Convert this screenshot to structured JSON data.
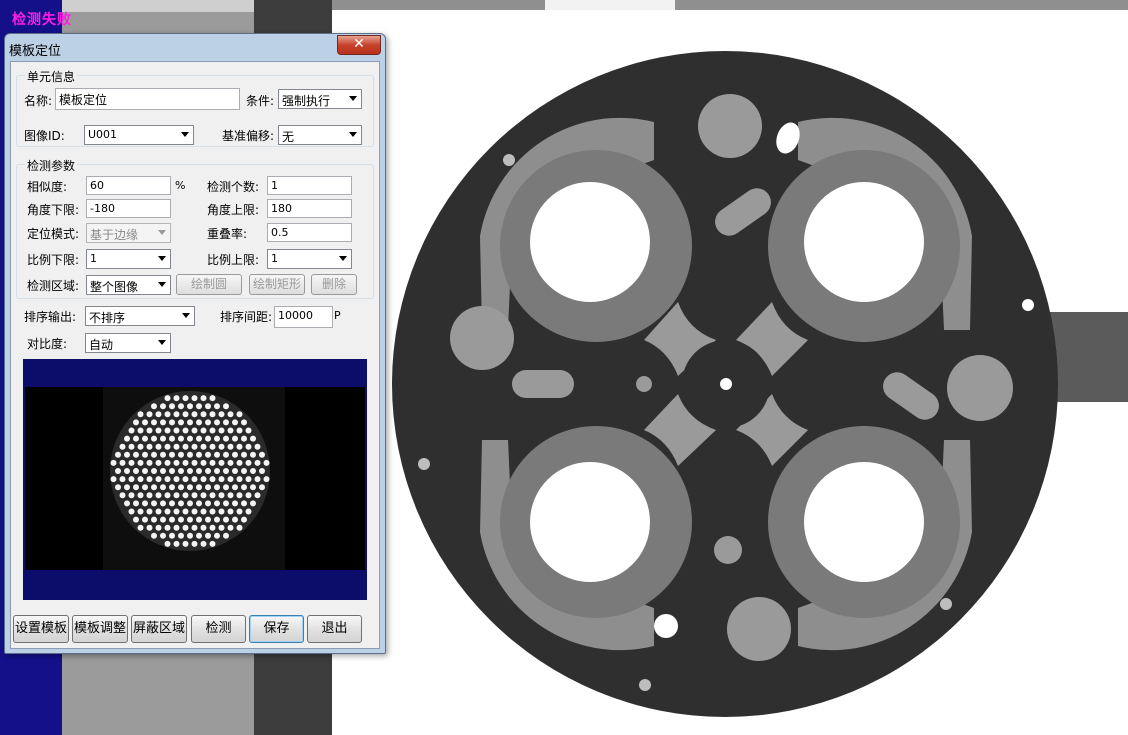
{
  "status": {
    "text": "检测失败",
    "color": "#ff1ce6"
  },
  "dialog": {
    "title": "模板定位",
    "close_icon": "✕",
    "unit_info": {
      "group_title": "单元信息",
      "name_label": "名称:",
      "name_value": "模板定位",
      "condition_label": "条件:",
      "condition_value": "强制执行",
      "image_id_label": "图像ID:",
      "image_id_value": "U001",
      "offset_label": "基准偏移:",
      "offset_value": "无"
    },
    "params": {
      "group_title": "检测参数",
      "similarity_label": "相似度:",
      "similarity_value": "60",
      "similarity_unit": "%",
      "count_label": "检测个数:",
      "count_value": "1",
      "angle_min_label": "角度下限:",
      "angle_min_value": "-180",
      "angle_max_label": "角度上限:",
      "angle_max_value": "180",
      "mode_label": "定位模式:",
      "mode_value": "基于边缘",
      "overlap_label": "重叠率:",
      "overlap_value": "0.5",
      "scale_min_label": "比例下限:",
      "scale_min_value": "1",
      "scale_max_label": "比例上限:",
      "scale_max_value": "1",
      "region_label": "检测区域:",
      "region_value": "整个图像",
      "draw_circle": "绘制圆",
      "draw_rect": "绘制矩形",
      "delete": "删除"
    },
    "sort_label": "排序输出:",
    "sort_value": "不排序",
    "sort_gap_label": "排序间距:",
    "sort_gap_value": "10000",
    "sort_gap_unit": "P",
    "contrast_label": "对比度:",
    "contrast_value": "自动",
    "buttons": {
      "set_template": "设置模板",
      "adjust_template": "模板调整",
      "mask_region": "屏蔽区域",
      "detect": "检测",
      "save": "保存",
      "exit": "退出"
    }
  }
}
